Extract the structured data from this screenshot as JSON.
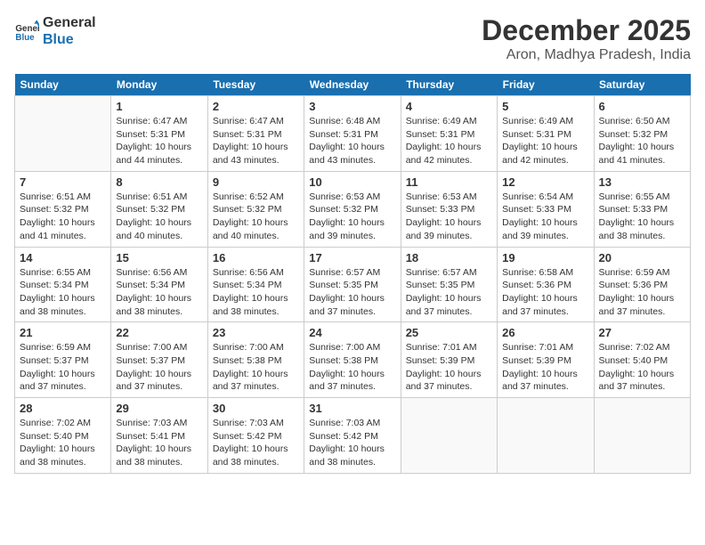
{
  "header": {
    "logo_line1": "General",
    "logo_line2": "Blue",
    "month_title": "December 2025",
    "subtitle": "Aron, Madhya Pradesh, India"
  },
  "weekdays": [
    "Sunday",
    "Monday",
    "Tuesday",
    "Wednesday",
    "Thursday",
    "Friday",
    "Saturday"
  ],
  "weeks": [
    [
      {
        "day": "",
        "info": ""
      },
      {
        "day": "1",
        "info": "Sunrise: 6:47 AM\nSunset: 5:31 PM\nDaylight: 10 hours\nand 44 minutes."
      },
      {
        "day": "2",
        "info": "Sunrise: 6:47 AM\nSunset: 5:31 PM\nDaylight: 10 hours\nand 43 minutes."
      },
      {
        "day": "3",
        "info": "Sunrise: 6:48 AM\nSunset: 5:31 PM\nDaylight: 10 hours\nand 43 minutes."
      },
      {
        "day": "4",
        "info": "Sunrise: 6:49 AM\nSunset: 5:31 PM\nDaylight: 10 hours\nand 42 minutes."
      },
      {
        "day": "5",
        "info": "Sunrise: 6:49 AM\nSunset: 5:31 PM\nDaylight: 10 hours\nand 42 minutes."
      },
      {
        "day": "6",
        "info": "Sunrise: 6:50 AM\nSunset: 5:32 PM\nDaylight: 10 hours\nand 41 minutes."
      }
    ],
    [
      {
        "day": "7",
        "info": "Sunrise: 6:51 AM\nSunset: 5:32 PM\nDaylight: 10 hours\nand 41 minutes."
      },
      {
        "day": "8",
        "info": "Sunrise: 6:51 AM\nSunset: 5:32 PM\nDaylight: 10 hours\nand 40 minutes."
      },
      {
        "day": "9",
        "info": "Sunrise: 6:52 AM\nSunset: 5:32 PM\nDaylight: 10 hours\nand 40 minutes."
      },
      {
        "day": "10",
        "info": "Sunrise: 6:53 AM\nSunset: 5:32 PM\nDaylight: 10 hours\nand 39 minutes."
      },
      {
        "day": "11",
        "info": "Sunrise: 6:53 AM\nSunset: 5:33 PM\nDaylight: 10 hours\nand 39 minutes."
      },
      {
        "day": "12",
        "info": "Sunrise: 6:54 AM\nSunset: 5:33 PM\nDaylight: 10 hours\nand 39 minutes."
      },
      {
        "day": "13",
        "info": "Sunrise: 6:55 AM\nSunset: 5:33 PM\nDaylight: 10 hours\nand 38 minutes."
      }
    ],
    [
      {
        "day": "14",
        "info": "Sunrise: 6:55 AM\nSunset: 5:34 PM\nDaylight: 10 hours\nand 38 minutes."
      },
      {
        "day": "15",
        "info": "Sunrise: 6:56 AM\nSunset: 5:34 PM\nDaylight: 10 hours\nand 38 minutes."
      },
      {
        "day": "16",
        "info": "Sunrise: 6:56 AM\nSunset: 5:34 PM\nDaylight: 10 hours\nand 38 minutes."
      },
      {
        "day": "17",
        "info": "Sunrise: 6:57 AM\nSunset: 5:35 PM\nDaylight: 10 hours\nand 37 minutes."
      },
      {
        "day": "18",
        "info": "Sunrise: 6:57 AM\nSunset: 5:35 PM\nDaylight: 10 hours\nand 37 minutes."
      },
      {
        "day": "19",
        "info": "Sunrise: 6:58 AM\nSunset: 5:36 PM\nDaylight: 10 hours\nand 37 minutes."
      },
      {
        "day": "20",
        "info": "Sunrise: 6:59 AM\nSunset: 5:36 PM\nDaylight: 10 hours\nand 37 minutes."
      }
    ],
    [
      {
        "day": "21",
        "info": "Sunrise: 6:59 AM\nSunset: 5:37 PM\nDaylight: 10 hours\nand 37 minutes."
      },
      {
        "day": "22",
        "info": "Sunrise: 7:00 AM\nSunset: 5:37 PM\nDaylight: 10 hours\nand 37 minutes."
      },
      {
        "day": "23",
        "info": "Sunrise: 7:00 AM\nSunset: 5:38 PM\nDaylight: 10 hours\nand 37 minutes."
      },
      {
        "day": "24",
        "info": "Sunrise: 7:00 AM\nSunset: 5:38 PM\nDaylight: 10 hours\nand 37 minutes."
      },
      {
        "day": "25",
        "info": "Sunrise: 7:01 AM\nSunset: 5:39 PM\nDaylight: 10 hours\nand 37 minutes."
      },
      {
        "day": "26",
        "info": "Sunrise: 7:01 AM\nSunset: 5:39 PM\nDaylight: 10 hours\nand 37 minutes."
      },
      {
        "day": "27",
        "info": "Sunrise: 7:02 AM\nSunset: 5:40 PM\nDaylight: 10 hours\nand 37 minutes."
      }
    ],
    [
      {
        "day": "28",
        "info": "Sunrise: 7:02 AM\nSunset: 5:40 PM\nDaylight: 10 hours\nand 38 minutes."
      },
      {
        "day": "29",
        "info": "Sunrise: 7:03 AM\nSunset: 5:41 PM\nDaylight: 10 hours\nand 38 minutes."
      },
      {
        "day": "30",
        "info": "Sunrise: 7:03 AM\nSunset: 5:42 PM\nDaylight: 10 hours\nand 38 minutes."
      },
      {
        "day": "31",
        "info": "Sunrise: 7:03 AM\nSunset: 5:42 PM\nDaylight: 10 hours\nand 38 minutes."
      },
      {
        "day": "",
        "info": ""
      },
      {
        "day": "",
        "info": ""
      },
      {
        "day": "",
        "info": ""
      }
    ]
  ]
}
